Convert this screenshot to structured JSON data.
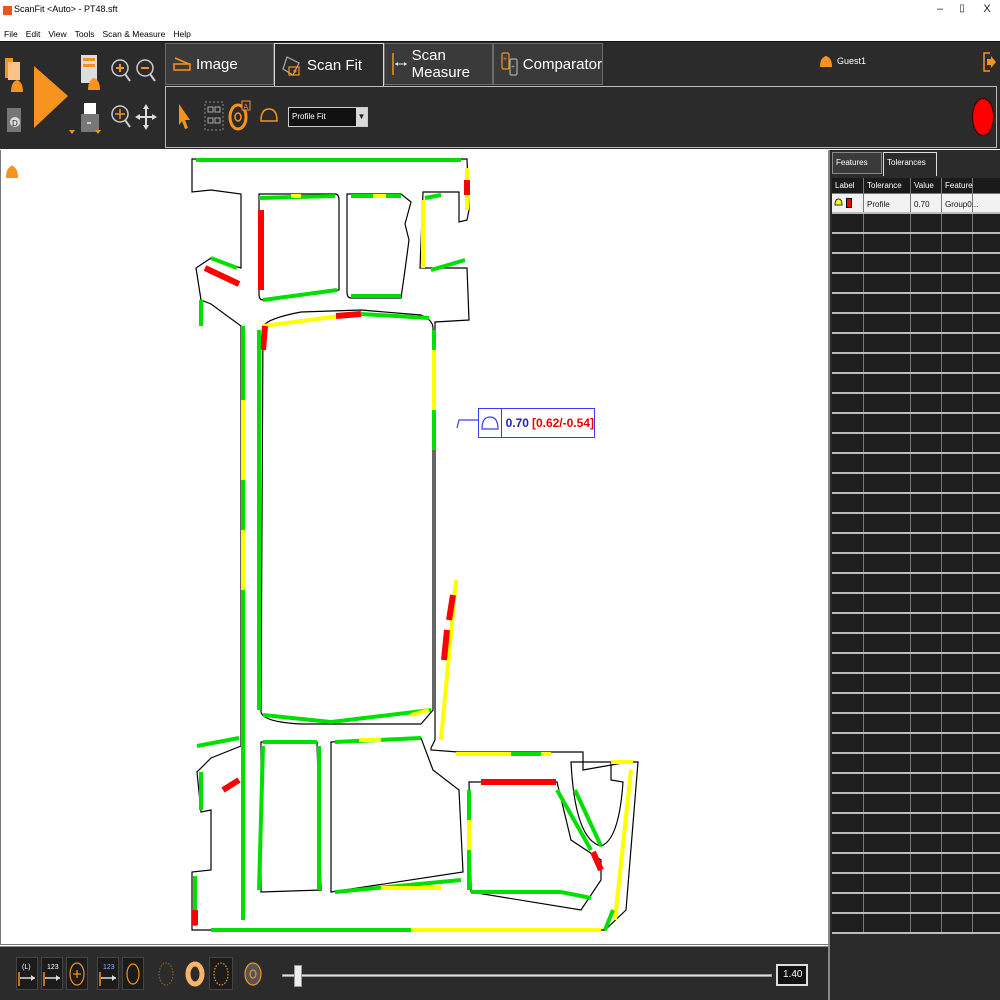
{
  "window": {
    "title": "ScanFit <Auto> - PT48.sft",
    "minimize": "–",
    "restore": "▯",
    "close": "X"
  },
  "menu": [
    "File",
    "Edit",
    "View",
    "Tools",
    "Scan & Measure",
    "Help"
  ],
  "tabs": [
    {
      "label": "Image",
      "icon": "scanner-icon",
      "active": false
    },
    {
      "label": "Scan Fit",
      "icon": "scan-fit-icon",
      "active": true
    },
    {
      "label": "Scan Measure",
      "icon": "measure-icon",
      "active": false
    },
    {
      "label": "Comparator",
      "icon": "comparator-icon",
      "active": false
    }
  ],
  "user": {
    "name": "Guest1"
  },
  "toolbar": {
    "fit_mode": "Profile Fit"
  },
  "status": {
    "indicator_color": "#ff0000"
  },
  "callout": {
    "value": "0.70",
    "range": "[0.62/-0.54]"
  },
  "side_panel": {
    "tabs": [
      {
        "label": "Features",
        "active": false
      },
      {
        "label": "Tolerances",
        "active": true
      }
    ],
    "columns": [
      "Label",
      "Tolerance",
      "Value",
      "Feature",
      ""
    ],
    "rows": [
      {
        "tolerance": "Profile",
        "value": "0.70",
        "feature": "Group0..."
      }
    ],
    "empty_rows": 36
  },
  "bottom": {
    "btn_labels": [
      "(L)",
      "123",
      "",
      "123"
    ],
    "zoom_value": "1.40",
    "zoom_fraction": 0.02
  },
  "colors": {
    "accent": "#f7931e",
    "ok": "#00e000",
    "warn": "#ffff00",
    "fail": "#ff0000",
    "callout": "#3a3aff"
  }
}
